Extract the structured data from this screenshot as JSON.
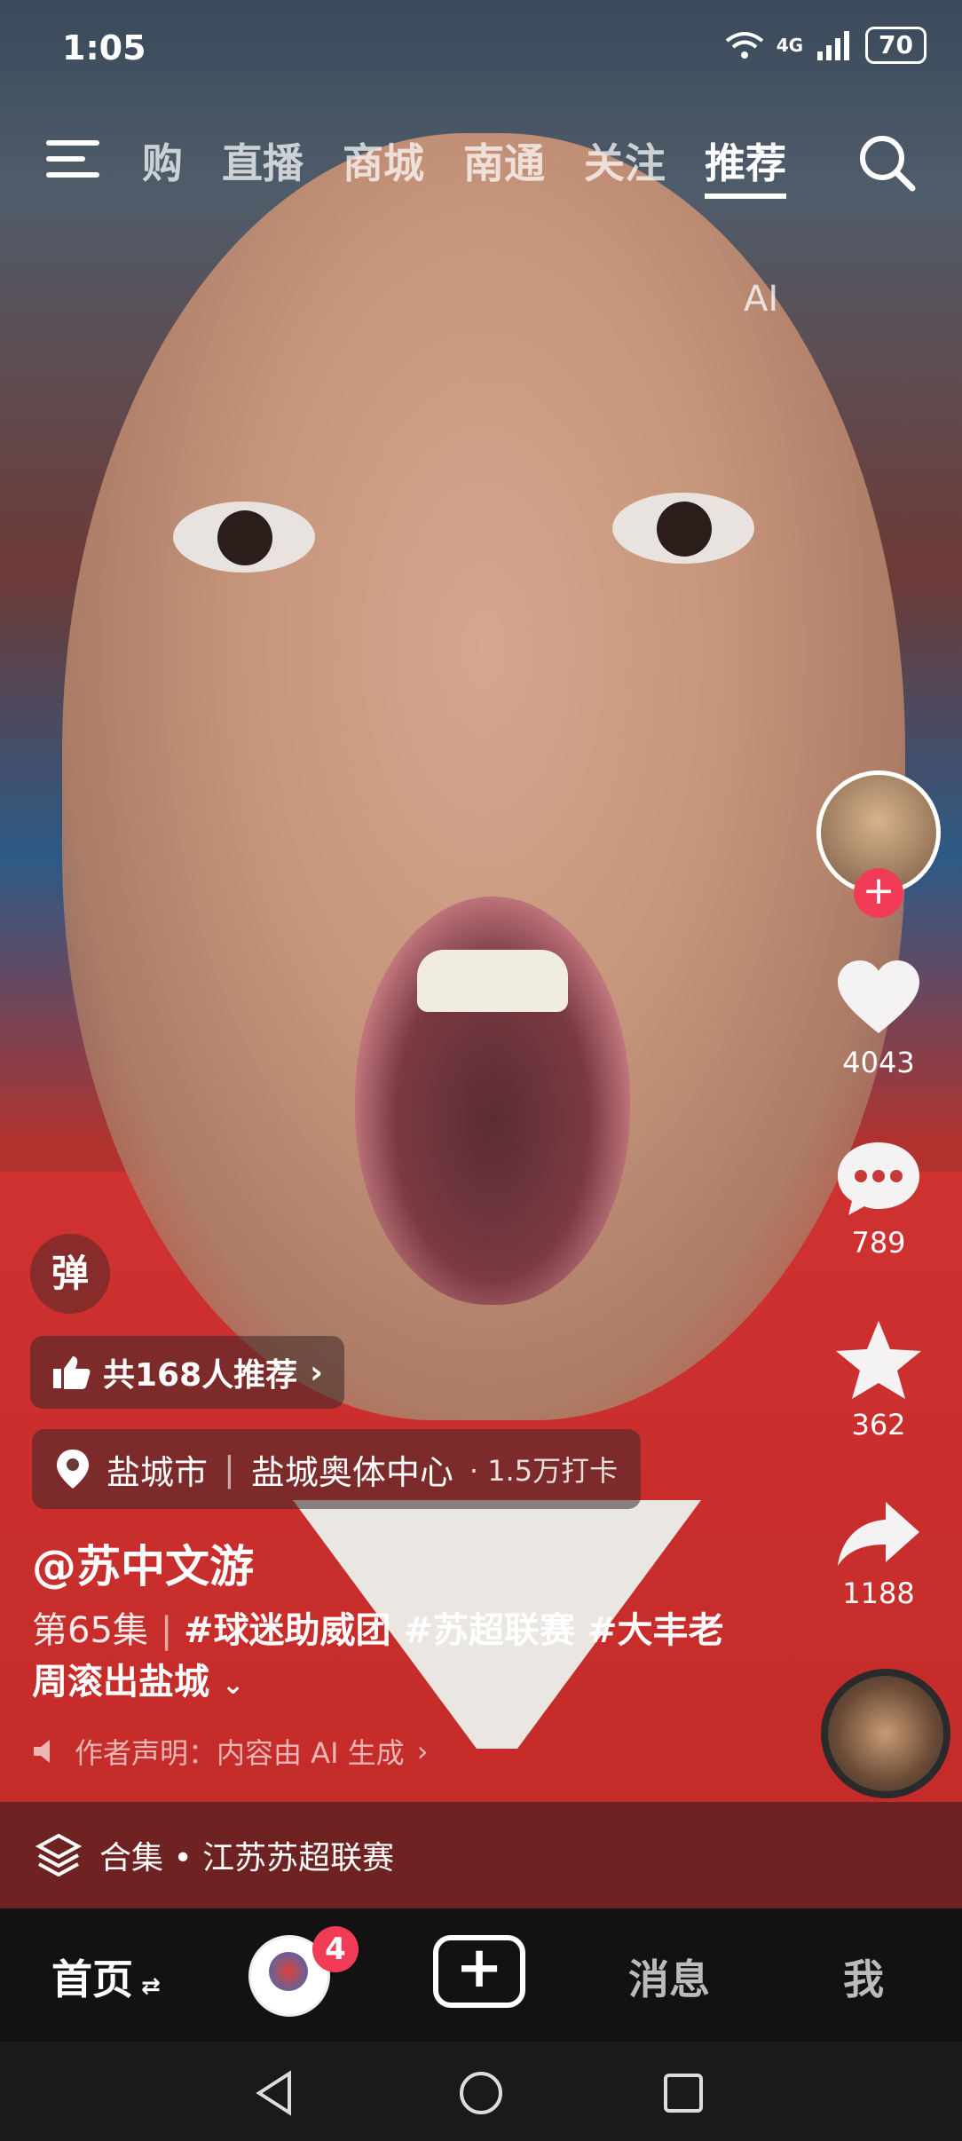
{
  "status_bar": {
    "time": "1:05",
    "network": "4G",
    "battery": "70"
  },
  "top_nav": {
    "tabs": [
      "购",
      "直播",
      "商城",
      "南通",
      "关注",
      "推荐"
    ],
    "active_tab": "推荐"
  },
  "ai_mark": "AI",
  "right_rail": {
    "likes": "4043",
    "comments": "789",
    "favorites": "362",
    "shares": "1188"
  },
  "danmu_label": "弹",
  "recommend": {
    "text": "共168人推荐"
  },
  "location": {
    "city": "盐城市",
    "place": "盐城奥体中心",
    "checkins": "· 1.5万打卡"
  },
  "post": {
    "author": "@苏中文游",
    "episode": "第65集",
    "description": "#球迷助威团 #苏超联赛 #大丰老周滚出盐城",
    "disclaimer": "作者声明：内容由 AI 生成"
  },
  "collection": {
    "text": "合集 • 江苏苏超联赛"
  },
  "bottom_tabs": {
    "home": "首页",
    "badge_count": "4",
    "messages": "消息",
    "me": "我"
  }
}
